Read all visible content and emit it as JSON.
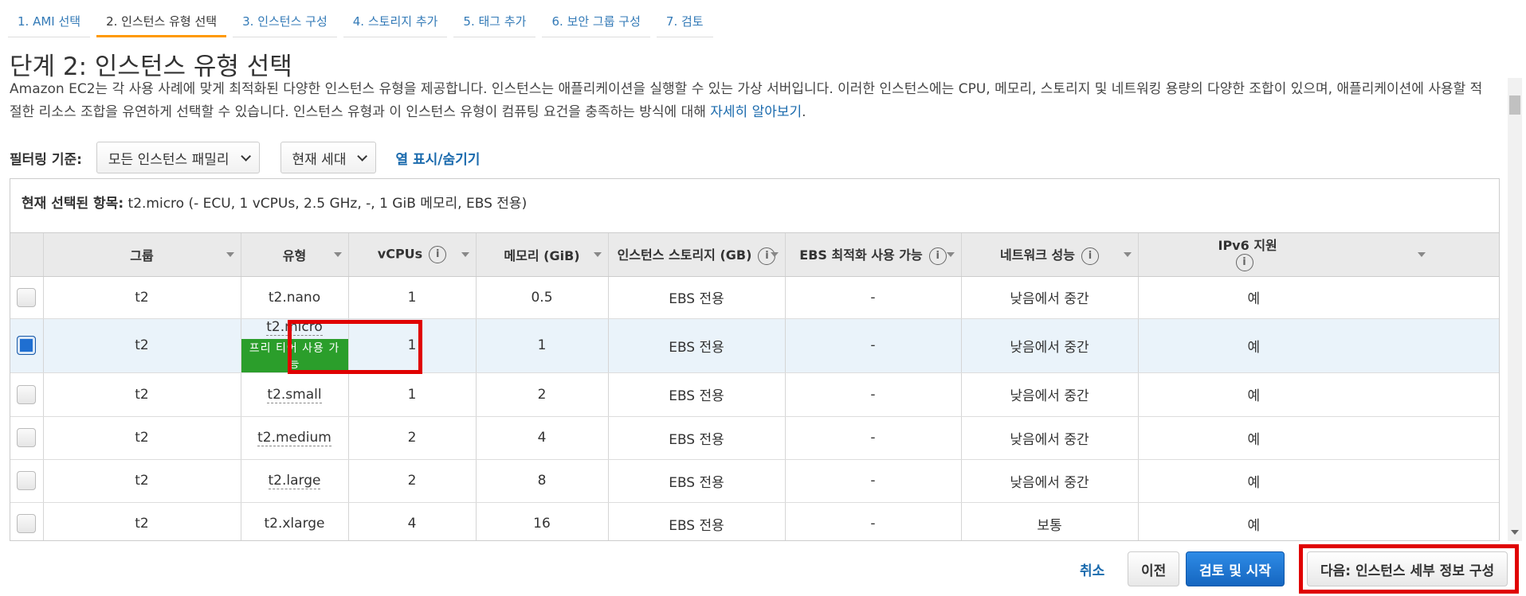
{
  "steps": [
    {
      "label": "1. AMI 선택"
    },
    {
      "label": "2. 인스턴스 유형 선택",
      "active": true
    },
    {
      "label": "3. 인스턴스 구성"
    },
    {
      "label": "4. 스토리지 추가"
    },
    {
      "label": "5. 태그 추가"
    },
    {
      "label": "6. 보안 그룹 구성"
    },
    {
      "label": "7. 검토"
    }
  ],
  "page_title": "단계 2: 인스턴스 유형 선택",
  "description": {
    "text": "Amazon EC2는 각 사용 사례에 맞게 최적화된 다양한 인스턴스 유형을 제공합니다. 인스턴스는 애플리케이션을 실행할 수 있는 가상 서버입니다. 이러한 인스턴스에는 CPU, 메모리, 스토리지 및 네트워킹 용량의 다양한 조합이 있으며, 애플리케이션에 사용할 적절한 리소스 조합을 유연하게 선택할 수 있습니다. 인스턴스 유형과 이 인스턴스 유형이 컴퓨팅 요건을 충족하는 방식에 대해 ",
    "link": "자세히 알아보기",
    "end": "."
  },
  "filter": {
    "label": "필터링 기준:",
    "family": "모든 인스턴스 패밀리",
    "generation": "현재 세대",
    "toggle_columns": "열 표시/숨기기"
  },
  "selected": {
    "label": "현재 선택된 항목:",
    "value": "t2.micro (- ECU, 1 vCPUs, 2.5 GHz, -, 1 GiB 메모리, EBS 전용)"
  },
  "table": {
    "headers": {
      "group": "그룹",
      "type": "유형",
      "vcpus": "vCPUs",
      "memory": "메모리 (GiB)",
      "storage": "인스턴스 스토리지 (GB)",
      "ebs": "EBS 최적화 사용 가능",
      "network": "네트워크 성능",
      "ipv6": "IPv6 지원"
    },
    "info_glyph": "i",
    "free_tier_badge": "프리 티어 사용 가능",
    "rows": [
      {
        "group": "t2",
        "type": "t2.nano",
        "vcpus": "1",
        "memory": "0.5",
        "storage": "EBS 전용",
        "ebs": "-",
        "network": "낮음에서 중간",
        "ipv6": "예",
        "checked": false
      },
      {
        "group": "t2",
        "type": "t2.micro",
        "vcpus": "1",
        "memory": "1",
        "storage": "EBS 전용",
        "ebs": "-",
        "network": "낮음에서 중간",
        "ipv6": "예",
        "checked": true,
        "free_tier": true
      },
      {
        "group": "t2",
        "type": "t2.small",
        "vcpus": "1",
        "memory": "2",
        "storage": "EBS 전용",
        "ebs": "-",
        "network": "낮음에서 중간",
        "ipv6": "예",
        "checked": false
      },
      {
        "group": "t2",
        "type": "t2.medium",
        "vcpus": "2",
        "memory": "4",
        "storage": "EBS 전용",
        "ebs": "-",
        "network": "낮음에서 중간",
        "ipv6": "예",
        "checked": false
      },
      {
        "group": "t2",
        "type": "t2.large",
        "vcpus": "2",
        "memory": "8",
        "storage": "EBS 전용",
        "ebs": "-",
        "network": "낮음에서 중간",
        "ipv6": "예",
        "checked": false
      },
      {
        "group": "t2",
        "type": "t2.xlarge",
        "vcpus": "4",
        "memory": "16",
        "storage": "EBS 전용",
        "ebs": "-",
        "network": "보통",
        "ipv6": "예",
        "checked": false
      }
    ]
  },
  "footer": {
    "cancel": "취소",
    "previous": "이전",
    "review_launch": "검토 및 시작",
    "next": "다음: 인스턴스 세부 정보 구성"
  },
  "colors": {
    "accent": "#1a6aad",
    "highlight": "#e00000",
    "free_tier": "#2b9e2b",
    "active_tab": "#ff9900"
  }
}
